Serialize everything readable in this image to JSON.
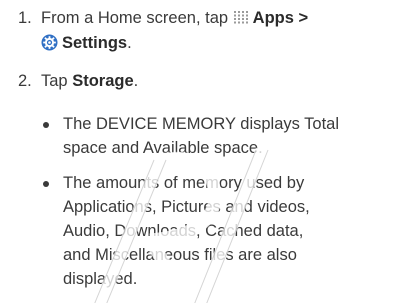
{
  "step1": {
    "number": "1.",
    "text_a": "From a Home screen, tap",
    "apps": "Apps",
    "separator": ">",
    "settings": "Settings",
    "period": "."
  },
  "step2": {
    "number": "2.",
    "text_a": "Tap",
    "storage": "Storage",
    "period": "."
  },
  "bullet1": {
    "line1": "The DEVICE MEMORY displays Total",
    "line2": "space and Available space."
  },
  "bullet2": {
    "line1": "The amounts of memory used by",
    "line2": "Applications, Pictures and videos,",
    "line3": "Audio, Downloads, Cached data,",
    "line4": "and Miscellaneous files are also",
    "line5": "displayed."
  },
  "icons": {
    "apps": "apps-grid-icon",
    "settings": "settings-gear-icon"
  },
  "colors": {
    "text": "#3a3a3a",
    "settings_icon": "#2f6fc4",
    "watermark": "#8a8a8a"
  }
}
